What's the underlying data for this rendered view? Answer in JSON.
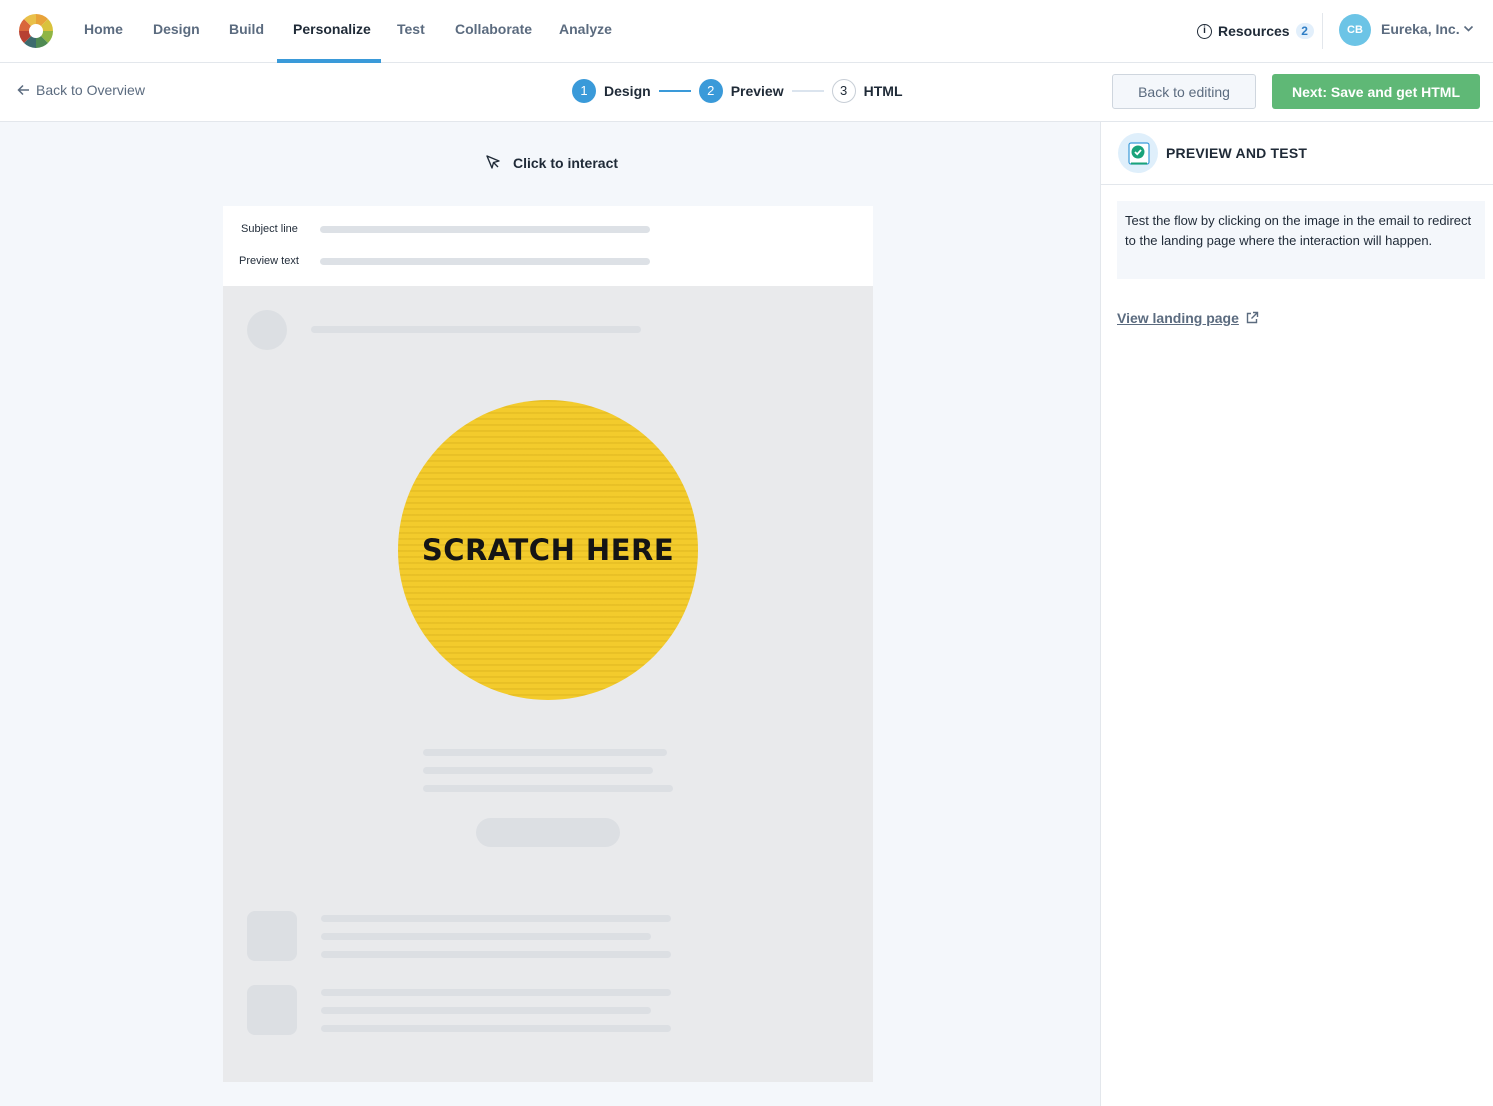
{
  "nav": {
    "items": [
      {
        "label": "Home"
      },
      {
        "label": "Design"
      },
      {
        "label": "Build"
      },
      {
        "label": "Personalize",
        "active": true
      },
      {
        "label": "Test"
      },
      {
        "label": "Collaborate"
      },
      {
        "label": "Analyze"
      }
    ],
    "resources_label": "Resources",
    "resources_count": "2",
    "avatar_initials": "CB",
    "org_name": "Eureka, Inc."
  },
  "subheader": {
    "back_label": "Back to Overview",
    "steps": [
      {
        "number": "1",
        "label": "Design",
        "state": "complete"
      },
      {
        "number": "2",
        "label": "Preview",
        "state": "current"
      },
      {
        "number": "3",
        "label": "HTML",
        "state": "upcoming"
      }
    ],
    "back_to_editing_label": "Back to editing",
    "next_label": "Next: Save and get HTML"
  },
  "canvas": {
    "interact_hint": "Click to interact",
    "subject_label": "Subject line",
    "preview_label": "Preview text",
    "scratch_text": "SCRATCH HERE"
  },
  "panel": {
    "title": "PREVIEW AND TEST",
    "description": "Test the flow by clicking on the image in the email to redirect to the landing page where the interaction will happen.",
    "link_label": "View landing page"
  },
  "colors": {
    "accent": "#3a9ad9",
    "primary_button": "#5fb876",
    "scratch_yellow": "#f3cb2c"
  }
}
